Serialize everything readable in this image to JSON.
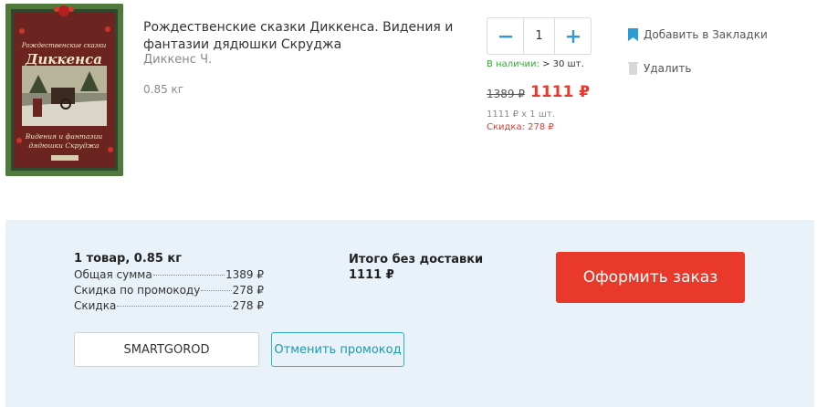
{
  "product": {
    "cover": {
      "series": "Рождественские сказки",
      "author": "Диккенса",
      "subtitle_line1": "Видения и фантазии",
      "subtitle_line2": "дядюшки Скруджа"
    },
    "title": "Рождественские сказки Диккенса. Видения и фантазии дядюшки Скруджа",
    "author": "Диккенс Ч.",
    "weight": "0.85 кг",
    "quantity": "1",
    "stock_label": "В наличии:",
    "stock_value": "> 30 шт.",
    "old_price": "1389 ₽",
    "new_price": "1111 ₽",
    "unit_line": "1111 ₽ x 1 шт.",
    "discount_line": "Скидка: 278 ₽",
    "bookmark_label": "Добавить в Закладки",
    "remove_label": "Удалить"
  },
  "summary": {
    "count": "1 товар, 0.85 кг",
    "rows": [
      {
        "label": "Общая сумма",
        "value": "1389 ₽"
      },
      {
        "label": "Скидка по промокоду",
        "value": "278 ₽"
      },
      {
        "label": "Скидка",
        "value": "278 ₽"
      }
    ],
    "total_label": "Итого без доставки",
    "total_value": "1111 ₽",
    "order_button": "Оформить заказ",
    "promo_code": "SMARTGOROD",
    "cancel_promo": "Отменить промокод"
  },
  "colors": {
    "accent_red": "#e8392a",
    "accent_blue": "#2a9bd7",
    "in_stock_green": "#3aa635",
    "panel_bg": "#e8f2f8"
  },
  "icons": {
    "minus": "minus-icon",
    "plus": "plus-icon",
    "bookmark": "bookmark-icon",
    "remove": "trash-icon"
  }
}
